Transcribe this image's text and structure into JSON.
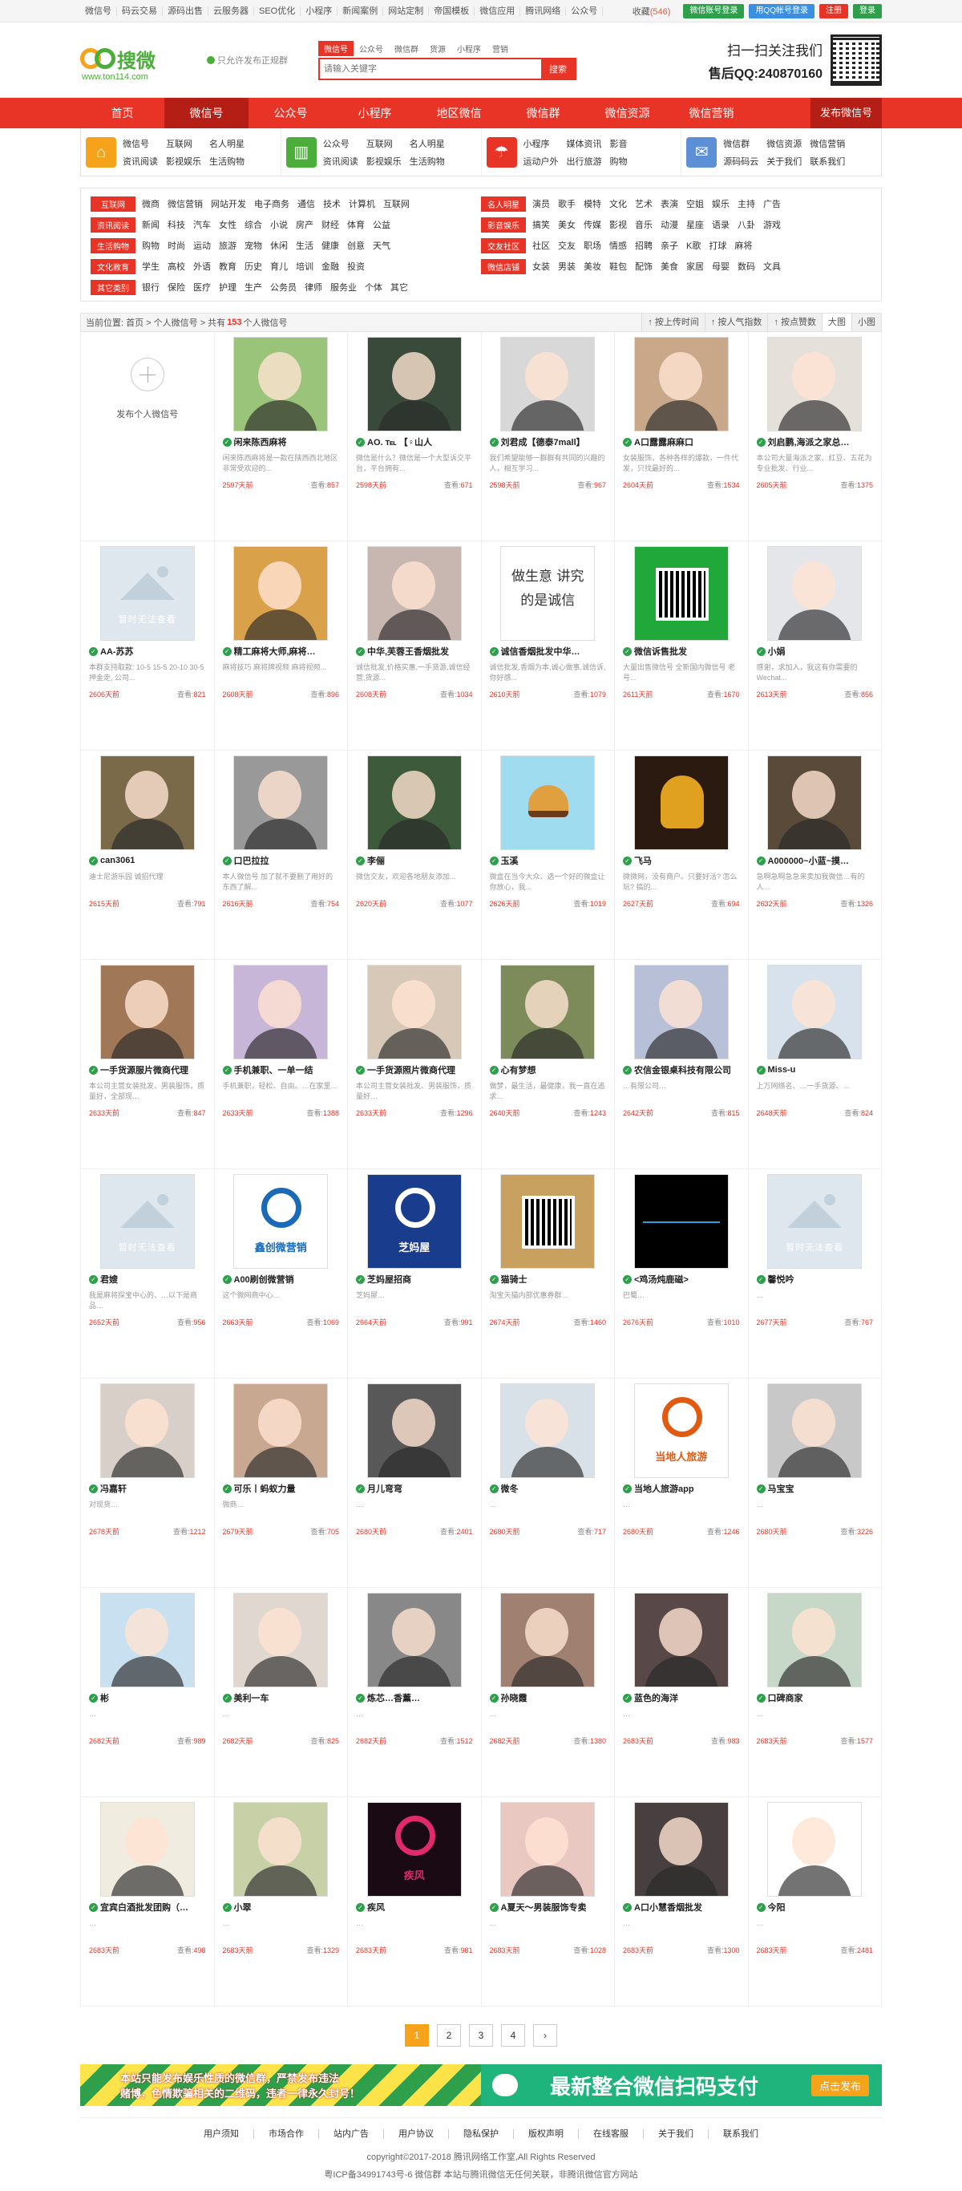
{
  "topbar": {
    "links": [
      "微信号",
      "码云交易",
      "源码出售",
      "云服务器",
      "SEO优化",
      "小程序",
      "新闻案例",
      "网站定制",
      "帝国模板",
      "微信应用",
      "腾讯网络",
      "公众号"
    ],
    "fav": "收藏",
    "fav_count": "(546)",
    "wx_login": "微信账号登录",
    "qq_login": "用QQ帐号登录",
    "register": "注册",
    "login": "登录"
  },
  "header": {
    "logo_text": "搜微",
    "logo_url": "www.ton114.com",
    "slogan": "只允许发布正规群",
    "search_tabs": [
      "微信号",
      "公众号",
      "微信群",
      "货源",
      "小程序",
      "营销"
    ],
    "search_placeholder": "请输入关键字",
    "search_btn": "搜索",
    "follow": "扫一扫关注我们",
    "qq": "售后QQ:240870160"
  },
  "nav": {
    "items": [
      "首页",
      "微信号",
      "公众号",
      "小程序",
      "地区微信",
      "微信群",
      "微信资源",
      "微信营销"
    ],
    "publish": "发布微信号"
  },
  "cats": [
    {
      "icon": "home-icon",
      "color": "#f7a21b",
      "items": [
        "微信号",
        "互联网",
        "名人明星",
        "资讯阅读",
        "影视娱乐",
        "生活购物"
      ]
    },
    {
      "icon": "chart-icon",
      "color": "#4cae3a",
      "items": [
        "公众号",
        "互联网",
        "名人明星",
        "资讯阅读",
        "影视娱乐",
        "生活购物"
      ]
    },
    {
      "icon": "umbrella-icon",
      "color": "#e73427",
      "items": [
        "小程序",
        "媒体资讯",
        "影音",
        "运动户外",
        "出行旅游",
        "购物"
      ]
    },
    {
      "icon": "megaphone-icon",
      "color": "#5d8fd6",
      "items": [
        "微信群",
        "微信资源",
        "微信营销",
        "源码码云",
        "关于我们",
        "联系我们"
      ]
    }
  ],
  "tags": [
    [
      {
        "label": "互联网",
        "items": [
          "微商",
          "微信营销",
          "网站开发",
          "电子商务",
          "通信",
          "技术",
          "计算机",
          "互联网"
        ]
      },
      {
        "label": "名人明星",
        "items": [
          "演员",
          "歌手",
          "模特",
          "文化",
          "艺术",
          "表演",
          "空姐",
          "娱乐",
          "主持",
          "广告"
        ]
      }
    ],
    [
      {
        "label": "资讯阅读",
        "items": [
          "新闻",
          "科技",
          "汽车",
          "女性",
          "综合",
          "小说",
          "房产",
          "财经",
          "体育",
          "公益"
        ]
      },
      {
        "label": "影音娱乐",
        "items": [
          "搞笑",
          "美女",
          "传媒",
          "影视",
          "音乐",
          "动漫",
          "星座",
          "语录",
          "八卦",
          "游戏"
        ]
      }
    ],
    [
      {
        "label": "生活购物",
        "items": [
          "购物",
          "时尚",
          "运动",
          "旅游",
          "宠物",
          "休闲",
          "生活",
          "健康",
          "创意",
          "天气"
        ]
      },
      {
        "label": "交友社区",
        "items": [
          "社区",
          "交友",
          "职场",
          "情感",
          "招聘",
          "亲子",
          "K歌",
          "打球",
          "麻将"
        ]
      }
    ],
    [
      {
        "label": "文化教育",
        "items": [
          "学生",
          "高校",
          "外语",
          "教育",
          "历史",
          "育儿",
          "培训",
          "金融",
          "投资"
        ]
      },
      {
        "label": "微信店铺",
        "items": [
          "女装",
          "男装",
          "美妆",
          "鞋包",
          "配饰",
          "美食",
          "家居",
          "母婴",
          "数码",
          "文具"
        ]
      }
    ],
    [
      {
        "label": "其它类别",
        "items": [
          "银行",
          "保险",
          "医疗",
          "护理",
          "生产",
          "公务员",
          "律师",
          "服务业",
          "个体",
          "其它"
        ]
      }
    ]
  ],
  "crumb": {
    "prefix": "当前位置: 首页 > 个人微信号 > 共有",
    "count": "153",
    "suffix": "个人微信号"
  },
  "sorts": [
    "按上传时间",
    "按人气指数",
    "按点赞数",
    "大图",
    "小图"
  ],
  "add_label": "发布个人微信号",
  "view_label": "查看:",
  "noimg_text": "暂时无法查看",
  "cards": [
    {
      "name": "闲来陈西麻将",
      "desc": "闲来陈西麻将是一款在陕西西北地区非常受欢迎的...",
      "days": "2597天前",
      "views": "857",
      "bg": "#9ac47a",
      "type": "face"
    },
    {
      "name": "AO. ℡ 【♀山人",
      "desc": "微信是什么？微信是一个大型诉交平台，平台拥有...",
      "days": "2598天前",
      "views": "671",
      "bg": "#3a4a3a",
      "type": "face"
    },
    {
      "name": "刘君成【德泰7mall】",
      "desc": "我们希望能够一群群有共同的兴趣的人，相互学习...",
      "days": "2598天前",
      "views": "967",
      "bg": "#d8d8d8",
      "type": "face"
    },
    {
      "name": "A口露露麻麻口",
      "desc": "女装服饰，各种各样的爆款，一件代发，只找最好的...",
      "days": "2604天前",
      "views": "1534",
      "bg": "#c9a88a",
      "type": "face"
    },
    {
      "name": "刘启鹏,海派之家总…",
      "desc": "本公司大量海派之家、红豆、五花为专业批发、行业...",
      "days": "2605天前",
      "views": "1375",
      "bg": "#e6e0da",
      "type": "face"
    },
    {
      "name": "AA-苏苏",
      "desc": "本群支持取款: 10-5 15-5 20-10 30-5 押金走, 公司...",
      "days": "2606天前",
      "views": "821",
      "bg": "",
      "type": "noimg"
    },
    {
      "name": "精工麻将大师,麻将…",
      "desc": "麻将技巧 麻将牌视频 麻将视频...",
      "days": "2608天前",
      "views": "896",
      "bg": "#d9a14a",
      "type": "face"
    },
    {
      "name": "中华,芙蓉王香烟批发",
      "desc": "诚信批发,价格实惠,一手货源,诚信经营,货源...",
      "days": "2608天前",
      "views": "1034",
      "bg": "#c8b6b0",
      "type": "face"
    },
    {
      "name": "诚信香烟批发中华…",
      "desc": "诚信批发,香烟为本,诚心做事,诚信诉,你好感...",
      "days": "2610天前",
      "views": "1079",
      "bg": "#ffffff",
      "type": "text",
      "text": "做生意 讲究的是诚信"
    },
    {
      "name": "微信诉售批发",
      "desc": "大量出售微信号 全新国内微信号 老号...",
      "days": "2611天前",
      "views": "1670",
      "bg": "#20a83a",
      "type": "qr"
    },
    {
      "name": "小娟",
      "desc": "感谢，求加入，我这有你需要的 Wechat...",
      "days": "2613天前",
      "views": "856",
      "bg": "#e4e6ea",
      "type": "face"
    },
    {
      "name": "can3061",
      "desc": "迪士尼游乐园 诚招代理",
      "days": "2615天前",
      "views": "791",
      "bg": "#7a6a4a",
      "type": "face"
    },
    {
      "name": "口巴拉拉",
      "desc": "本人微信号 加了就不要删了用好的东西了解...",
      "days": "2616天前",
      "views": "754",
      "bg": "#999999",
      "type": "face"
    },
    {
      "name": "李俪",
      "desc": "微信交友，欢迎各地朋友添加...",
      "days": "2620天前",
      "views": "1077",
      "bg": "#3d5a3a",
      "type": "face"
    },
    {
      "name": "玉溪",
      "desc": "微盒在当今大众、选一个好的微盒让你放心，我...",
      "days": "2626天前",
      "views": "1019",
      "bg": "#9fdcf0",
      "type": "burger"
    },
    {
      "name": "飞马",
      "desc": "微微网，没有商户。只要好活? 怎么玩? 搞的...",
      "days": "2627天前",
      "views": "694",
      "bg": "#2a1a10",
      "type": "gold"
    },
    {
      "name": "A000000~小蓝~摸…",
      "desc": "急啊急啊急急来卖加我微信…有的人…",
      "days": "2632天前",
      "views": "1326",
      "bg": "#5a4a3a",
      "type": "face"
    },
    {
      "name": "一手货源服片微商代理",
      "desc": "本公司主营女装批发、男装服饰，质量好，全部现…",
      "days": "2633天前",
      "views": "847",
      "bg": "#a07858",
      "type": "face"
    },
    {
      "name": "手机兼职、一单一结",
      "desc": "手机兼职，轻松、自由。…在家里…",
      "days": "2633天前",
      "views": "1388",
      "bg": "#c8b6d8",
      "type": "face"
    },
    {
      "name": "一手货源照片微商代理",
      "desc": "本公司主营女装批发、男装服饰，质量好…",
      "days": "2633天前",
      "views": "1296",
      "bg": "#d8c8b8",
      "type": "face"
    },
    {
      "name": "心有梦想",
      "desc": "做梦，最生活，最健康，我一直在追求…",
      "days": "2640天前",
      "views": "1243",
      "bg": "#7d8a5a",
      "type": "face"
    },
    {
      "name": "农信金银桌科技有限公司",
      "desc": "…有限公司…",
      "days": "2642天前",
      "views": "815",
      "bg": "#b8c0d8",
      "type": "face"
    },
    {
      "name": "Miss-u",
      "desc": "上万网络名、…一手货源、…",
      "days": "2648天前",
      "views": "824",
      "bg": "#d8e2ec",
      "type": "face"
    },
    {
      "name": "君嫂",
      "desc": "我是麻将探宝中心的、…以下是商品…",
      "days": "2652天前",
      "views": "956",
      "bg": "",
      "type": "noimg"
    },
    {
      "name": "A00刷创微营销",
      "desc": "这个微网商中心…",
      "days": "2663天前",
      "views": "1069",
      "bg": "#ffffff",
      "type": "logo",
      "text": "鑫创微营销"
    },
    {
      "name": "芝妈屋招商",
      "desc": "芝妈屋…",
      "days": "2664天前",
      "views": "991",
      "bg": "#1a3c8c",
      "type": "logo2",
      "text": "芝妈屋"
    },
    {
      "name": "猫骑士",
      "desc": "淘宝天猫内部优惠券群…",
      "days": "2674天前",
      "views": "1460",
      "bg": "#c8a060",
      "type": "qr2"
    },
    {
      "name": "<鸡汤炖鹿磁>",
      "desc": "巴蜀…",
      "days": "2676天前",
      "views": "1010",
      "bg": "#000000",
      "type": "pulse"
    },
    {
      "name": "馨悦吟",
      "desc": "…",
      "days": "2677天前",
      "views": "767",
      "bg": "",
      "type": "noimg"
    },
    {
      "name": "冯嘉轩",
      "desc": "对现货…",
      "days": "2678天前",
      "views": "1212",
      "bg": "#d8d0c8",
      "type": "face"
    },
    {
      "name": "可乐丨蚂蚁力量",
      "desc": "微商…",
      "days": "2679天前",
      "views": "705",
      "bg": "#c8a890",
      "type": "face"
    },
    {
      "name": "月儿弯弯",
      "desc": "…",
      "days": "2680天前",
      "views": "2401",
      "bg": "#585858",
      "type": "face"
    },
    {
      "name": "微冬",
      "desc": "…",
      "days": "2680天前",
      "views": "717",
      "bg": "#d8e0e8",
      "type": "face"
    },
    {
      "name": "当地人旅游app",
      "desc": "…",
      "days": "2680天前",
      "views": "1246",
      "bg": "#ffffff",
      "type": "logo3",
      "text": "当地人旅游"
    },
    {
      "name": "马宝宝",
      "desc": "…",
      "days": "2680天前",
      "views": "3226",
      "bg": "#c8c8c8",
      "type": "face"
    },
    {
      "name": "彬",
      "desc": "…",
      "days": "2682天前",
      "views": "989",
      "bg": "#c8e0f0",
      "type": "face"
    },
    {
      "name": "美利一车",
      "desc": "…",
      "days": "2682天前",
      "views": "825",
      "bg": "#e0d8d0",
      "type": "face"
    },
    {
      "name": "炼芯…香薰…",
      "desc": "…",
      "days": "2682天前",
      "views": "1512",
      "bg": "#888888",
      "type": "face"
    },
    {
      "name": "孙晓霞",
      "desc": "…",
      "days": "2682天前",
      "views": "1380",
      "bg": "#a08070",
      "type": "face"
    },
    {
      "name": "蓝色的海洋",
      "desc": "…",
      "days": "2683天前",
      "views": "983",
      "bg": "#584848",
      "type": "face"
    },
    {
      "name": "口碑商家",
      "desc": "…",
      "days": "2683天前",
      "views": "1577",
      "bg": "#c8d8c8",
      "type": "face"
    },
    {
      "name": "宜宾白酒批发团购（…",
      "desc": "…",
      "days": "2683天前",
      "views": "498",
      "bg": "#f0ece0",
      "type": "face"
    },
    {
      "name": "小翠",
      "desc": "…",
      "days": "2683天前",
      "views": "1329",
      "bg": "#c8d0a8",
      "type": "face"
    },
    {
      "name": "疾风",
      "desc": "…",
      "days": "2683天前",
      "views": "981",
      "bg": "#1a0a14",
      "type": "logo4",
      "text": "疾风"
    },
    {
      "name": "A夏天～男装服饰专卖",
      "desc": "…",
      "days": "2683天前",
      "views": "1028",
      "bg": "#e8c8c0",
      "type": "face"
    },
    {
      "name": "A口小慧香烟批发",
      "desc": "…",
      "days": "2683天前",
      "views": "1300",
      "bg": "#484040",
      "type": "face"
    },
    {
      "name": "今阳",
      "desc": "…",
      "days": "2683天前",
      "views": "2481",
      "bg": "#ffffff",
      "type": "face"
    }
  ],
  "pager": [
    "1",
    "2",
    "3",
    "4",
    "›"
  ],
  "banner1": [
    "本站只能发布娱乐性质的微信群，严禁发布违法",
    "赌博，色情欺骗相关的二维码，违者一律永久封号！"
  ],
  "banner2": {
    "text": "最新整合微信扫码支付",
    "cta": "点击发布"
  },
  "footer": {
    "links": [
      "用户须知",
      "市场合作",
      "站内广告",
      "用户协议",
      "隐私保护",
      "版权声明",
      "在线客服",
      "关于我们",
      "联系我们"
    ],
    "copyright": "copyright©2017-2018 腾讯网络工作室,All Rights Reserved",
    "icp": "粤ICP备34991743号-6 微信群    本站与腾讯微信无任何关联，非腾讯微信官方网站"
  }
}
